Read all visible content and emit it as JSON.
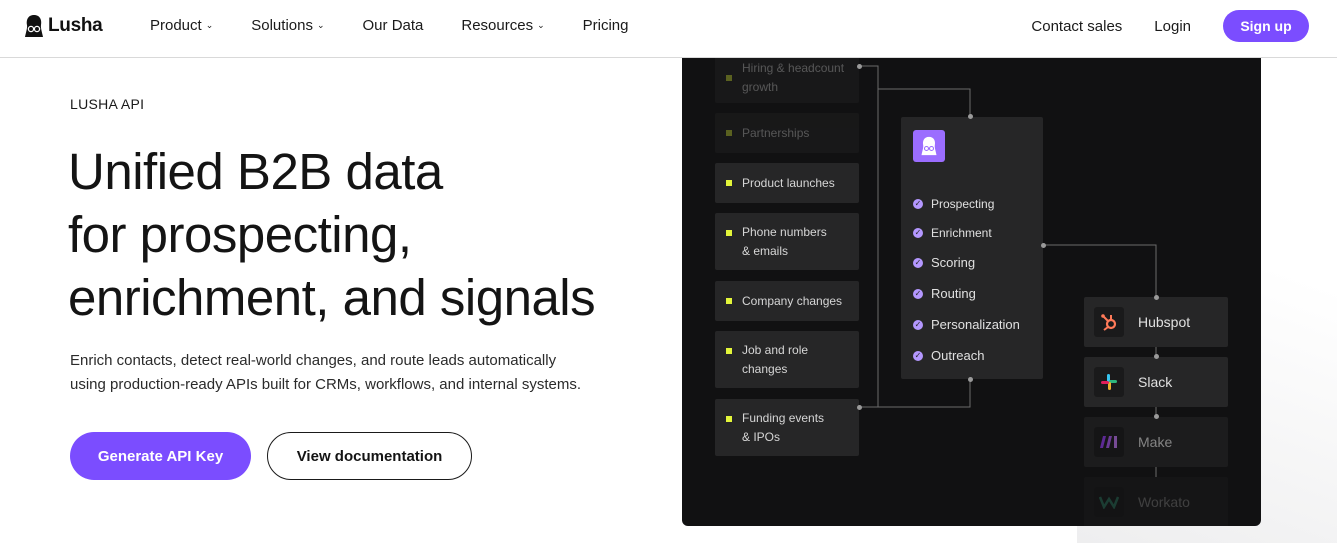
{
  "brand": {
    "name": "Lusha",
    "accent": "#7b4dff"
  },
  "nav": {
    "items": [
      {
        "label": "Product",
        "dropdown": true
      },
      {
        "label": "Solutions",
        "dropdown": true
      },
      {
        "label": "Our Data",
        "dropdown": false
      },
      {
        "label": "Resources",
        "dropdown": true
      },
      {
        "label": "Pricing",
        "dropdown": false
      }
    ],
    "contact": "Contact sales",
    "login": "Login",
    "signup": "Sign up"
  },
  "hero": {
    "eyebrow": "LUSHA API",
    "headline": [
      "Unified B2B data",
      "for prospecting,",
      "enrichment, and signals"
    ],
    "subtext": [
      "Enrich contacts, detect real-world changes, and route leads automatically",
      "using production-ready APIs built for CRMs, workflows, and internal systems."
    ],
    "primary_cta": "Generate API Key",
    "secondary_cta": "View documentation"
  },
  "diagram": {
    "sources": [
      "Hiring & headcount growth",
      "Partnerships",
      "Product launches",
      "Phone numbers & emails",
      "Company changes",
      "Job and role changes",
      "Funding events & IPOs"
    ],
    "hub_items": [
      "Prospecting",
      "Enrichment",
      "Scoring",
      "Routing",
      "Personalization",
      "Outreach"
    ],
    "destinations": [
      {
        "name": "Hubspot",
        "icon": "hubspot-icon",
        "color": "#ff7a59"
      },
      {
        "name": "Slack",
        "icon": "slack-icon",
        "color": "#36c5f0"
      },
      {
        "name": "Make",
        "icon": "make-icon",
        "color": "#9b3dff"
      },
      {
        "name": "Workato",
        "icon": "workato-icon",
        "color": "#3fd6a6"
      }
    ]
  }
}
